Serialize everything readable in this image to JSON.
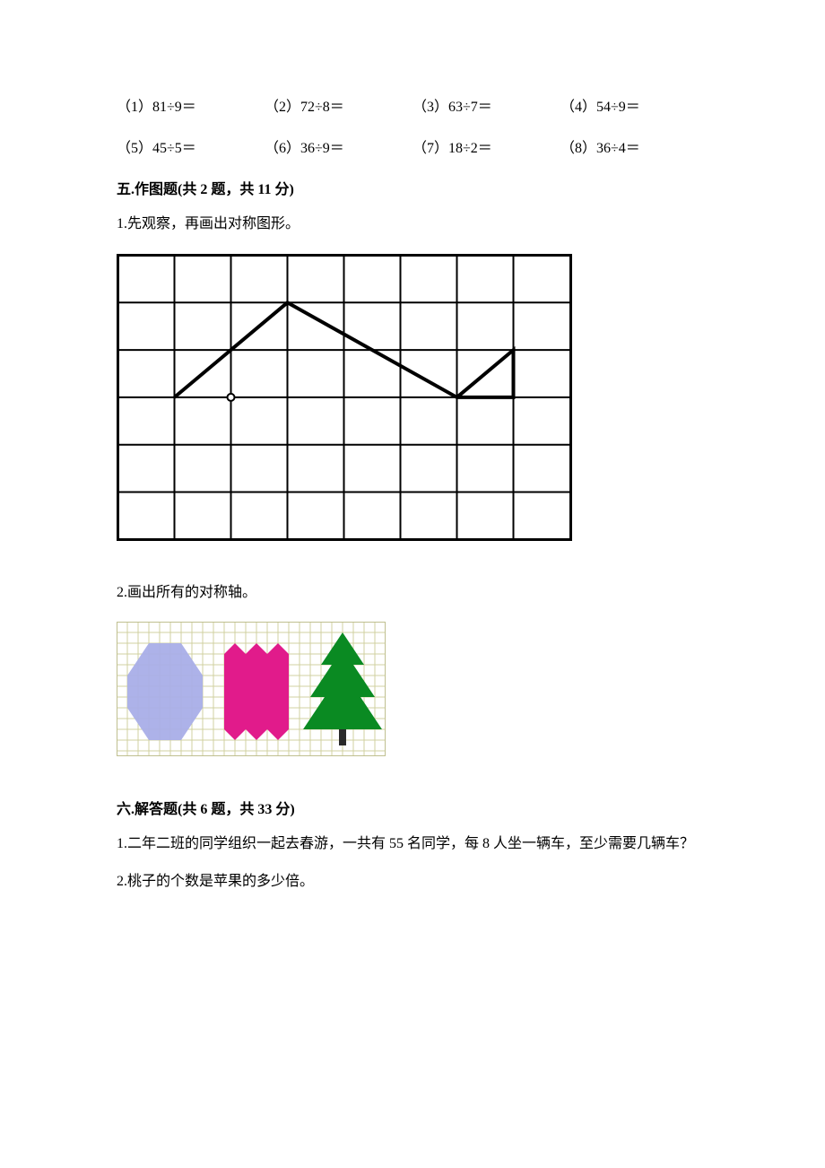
{
  "calc": {
    "row1": [
      "（1）81÷9＝",
      "（2）72÷8＝",
      "（3）63÷7＝",
      "（4）54÷9＝"
    ],
    "row2": [
      "（5）45÷5＝",
      "（6）36÷9＝",
      "（7）18÷2＝",
      "（8）36÷4＝"
    ]
  },
  "sec5": {
    "title": "五.作图题(共 2 题，共 11 分)",
    "q1": "1.先观察，再画出对称图形。",
    "q2": "2.画出所有的对称轴。"
  },
  "sec6": {
    "title": "六.解答题(共 6 题，共 33 分)",
    "q1": "1.二年二班的同学组织一起去春游，一共有 55 名同学，每 8 人坐一辆车，至少需要几辆车？",
    "q2": "2.桃子的个数是苹果的多少倍。"
  }
}
